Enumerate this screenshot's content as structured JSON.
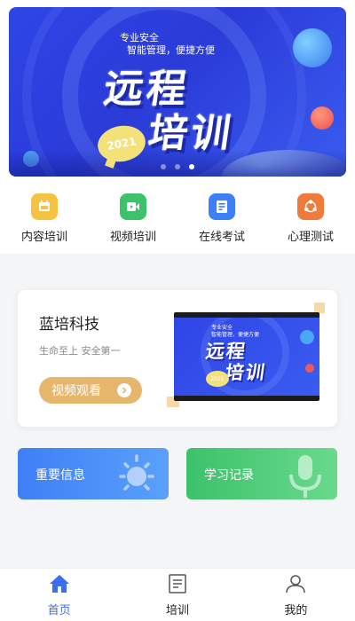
{
  "banner": {
    "slogan_line1": "专业安全",
    "slogan_line2": "智能管理，便捷方便",
    "title_line1": "远程",
    "title_line2": "培训",
    "year": "2021",
    "slide_count": 3,
    "active_slide": 3
  },
  "quick_nav": {
    "items": [
      {
        "label": "内容培训",
        "icon": "document-icon",
        "color": "#f5c242"
      },
      {
        "label": "视频培训",
        "icon": "video-icon",
        "color": "#3cc26b"
      },
      {
        "label": "在线考试",
        "icon": "exam-icon",
        "color": "#3f7ff6"
      },
      {
        "label": "心理测试",
        "icon": "share-icon",
        "color": "#f07a3a"
      }
    ]
  },
  "promo": {
    "title": "蓝培科技",
    "subtitle": "生命至上 安全第一",
    "button_label": "视频观看",
    "thumb_slogan_line1": "专业安全",
    "thumb_slogan_line2": "智能管理，便捷方便",
    "thumb_title_line1": "远程",
    "thumb_title_line2": "培训",
    "thumb_year": "2021"
  },
  "tiles": {
    "important": {
      "label": "重要信息",
      "icon": "sun-icon"
    },
    "records": {
      "label": "学习记录",
      "icon": "microphone-icon"
    }
  },
  "tabbar": {
    "items": [
      {
        "label": "首页",
        "icon": "home-icon",
        "active": true
      },
      {
        "label": "培训",
        "icon": "training-icon",
        "active": false
      },
      {
        "label": "我的",
        "icon": "user-icon",
        "active": false
      }
    ],
    "active_color": "#3a6ff0"
  }
}
